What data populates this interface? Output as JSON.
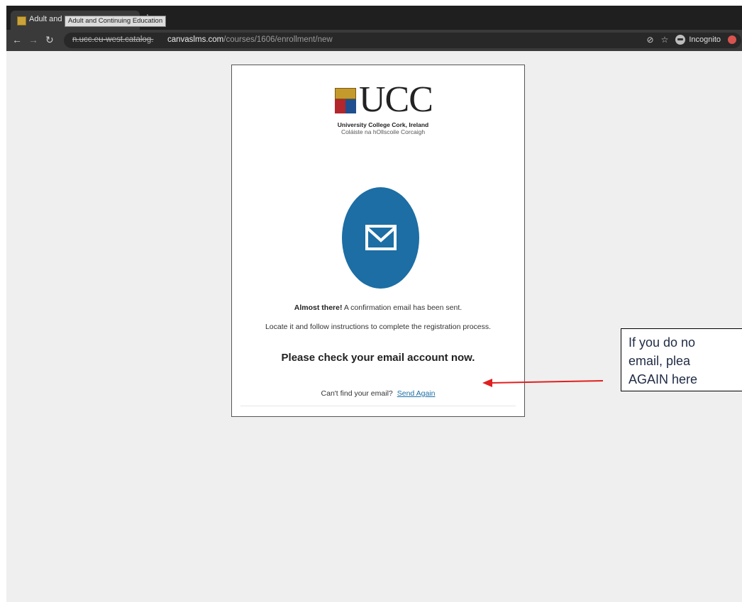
{
  "browser": {
    "tab_title": "Adult and Continuing Education",
    "tab_close": "x",
    "new_tab": "+",
    "url_prefix": "n.ucc.eu-west.catalog.",
    "url_domain": "canvaslms.com",
    "url_path": "/courses/1606/enrollment/new",
    "tooltip": "Adult and Continuing Education",
    "incognito_label": "Incognito"
  },
  "logo": {
    "wordmark": "UCC",
    "university_name": "University College Cork, Ireland",
    "irish_name": "Coláiste na hOllscoile Corcaigh"
  },
  "message": {
    "almost_there": "Almost there!",
    "confirmation": "A confirmation email has been sent.",
    "instructions": "Locate it and follow instructions to complete the registration process.",
    "check_email": "Please check your email account now.",
    "cant_find": "Can't find your email?",
    "send_again": "Send Again"
  },
  "callout": {
    "line1": "If you do no",
    "line2": "email, plea",
    "line3": "AGAIN here"
  },
  "colors": {
    "accent_blue": "#1c6ea4",
    "arrow_red": "#e0201f"
  }
}
